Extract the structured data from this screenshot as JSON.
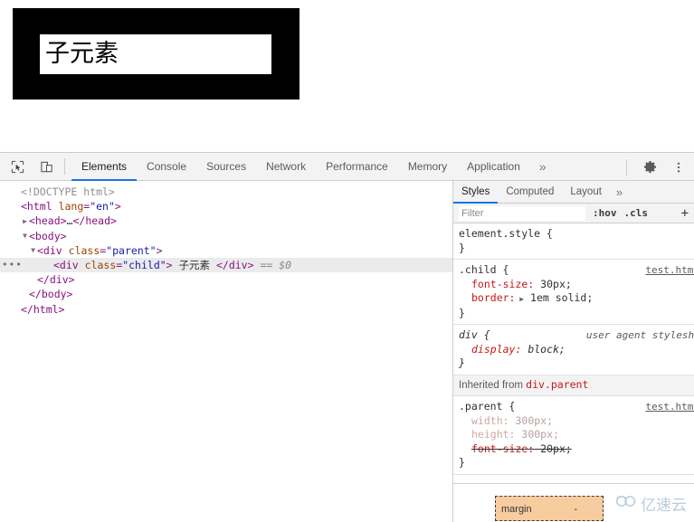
{
  "preview": {
    "parent_text": "",
    "child_text": "子元素"
  },
  "toolbar": {
    "inspect_icon": "inspect-cursor-icon",
    "device_icon": "device-toolbar-icon",
    "tabs": [
      {
        "label": "Elements",
        "active": true
      },
      {
        "label": "Console",
        "active": false
      },
      {
        "label": "Sources",
        "active": false
      },
      {
        "label": "Network",
        "active": false
      },
      {
        "label": "Performance",
        "active": false
      },
      {
        "label": "Memory",
        "active": false
      },
      {
        "label": "Application",
        "active": false
      }
    ],
    "more_tabs": "»",
    "settings_icon": "gear-icon",
    "menu_icon": "kebab-menu-icon"
  },
  "dom_tree": [
    {
      "indent": 0,
      "twisty": "",
      "html": "<span class=\"doctype\">&lt;!DOCTYPE html&gt;</span>",
      "selected": false
    },
    {
      "indent": 0,
      "twisty": "",
      "html": "<span class=\"tag\">&lt;html</span> <span class=\"attr-name\">lang</span><span class=\"tag\">=</span><span class=\"attr-val\">\"en\"</span><span class=\"tag\">&gt;</span>",
      "selected": false
    },
    {
      "indent": 1,
      "twisty": "▶",
      "html": "<span class=\"tag\">&lt;head&gt;</span><span class=\"txt\">…</span><span class=\"tag\">&lt;/head&gt;</span>",
      "selected": false
    },
    {
      "indent": 1,
      "twisty": "▼",
      "html": "<span class=\"tag\">&lt;body&gt;</span>",
      "selected": false
    },
    {
      "indent": 2,
      "twisty": "▼",
      "html": "<span class=\"tag\">&lt;div</span> <span class=\"attr-name\">class</span><span class=\"tag\">=</span><span class=\"attr-val\">\"parent\"</span><span class=\"tag\">&gt;</span>",
      "selected": false
    },
    {
      "indent": 4,
      "twisty": "",
      "html": "<span class=\"tag\">&lt;div</span> <span class=\"attr-name\">class</span><span class=\"tag\">=</span><span class=\"attr-val\">\"child\"</span><span class=\"tag\">&gt;</span> <span class=\"txt\">子元素</span> <span class=\"tag\">&lt;/div&gt;</span> <span class=\"dollar\">== $0</span>",
      "selected": true
    },
    {
      "indent": 2,
      "twisty": "",
      "html": "<span class=\"tag\">&lt;/div&gt;</span>",
      "selected": false
    },
    {
      "indent": 1,
      "twisty": "",
      "html": "<span class=\"tag\">&lt;/body&gt;</span>",
      "selected": false
    },
    {
      "indent": 0,
      "twisty": "",
      "html": "<span class=\"tag\">&lt;/html&gt;</span>",
      "selected": false
    }
  ],
  "styles": {
    "tabs": [
      {
        "label": "Styles",
        "active": true
      },
      {
        "label": "Computed",
        "active": false
      },
      {
        "label": "Layout",
        "active": false
      }
    ],
    "more_tabs": "»",
    "filter_placeholder": "Filter",
    "filter_value": "",
    "hov_label": ":hov",
    "cls_label": ".cls",
    "plus_label": "+",
    "rules": [
      {
        "kind": "rule",
        "selector": "element.style {",
        "close": "}",
        "source": "",
        "declarations": []
      },
      {
        "kind": "rule",
        "selector": ".child {",
        "close": "}",
        "source": "test.html",
        "declarations": [
          {
            "prop": "font-size",
            "value": "30px;",
            "arrow": false,
            "struck": false,
            "dim": false
          },
          {
            "prop": "border",
            "value": "1em solid;",
            "arrow": true,
            "struck": false,
            "dim": false
          }
        ]
      },
      {
        "kind": "ua",
        "selector": "div {",
        "close": "}",
        "source": "user agent stylesheet",
        "declarations": [
          {
            "prop": "display",
            "value": "block;",
            "arrow": false,
            "struck": false,
            "dim": false
          }
        ]
      },
      {
        "kind": "inherited-header",
        "text_prefix": "Inherited from ",
        "text_name": "div.parent"
      },
      {
        "kind": "rule",
        "selector": ".parent {",
        "close": "}",
        "source": "test.html",
        "declarations": [
          {
            "prop": "width",
            "value": "300px;",
            "arrow": false,
            "struck": false,
            "dim": true
          },
          {
            "prop": "height",
            "value": "300px;",
            "arrow": false,
            "struck": false,
            "dim": true
          },
          {
            "prop": "font-size",
            "value": "20px;",
            "arrow": false,
            "struck": true,
            "dim": false
          }
        ]
      }
    ],
    "box_model": {
      "margin_label": "margin",
      "margin_value": "-"
    }
  },
  "watermark": {
    "logo": "cloud-logo-icon",
    "text": "亿速云"
  },
  "colors": {
    "accent": "#1a73e8",
    "tag": "#881280",
    "attr_name": "#994500",
    "attr_value": "#1a1aa6",
    "property": "#c41a16",
    "margin_box": "#f7cc9f",
    "toolbar_bg": "#f3f3f3",
    "selected_row": "#ebebeb",
    "watermark": "#b9ccdd"
  }
}
